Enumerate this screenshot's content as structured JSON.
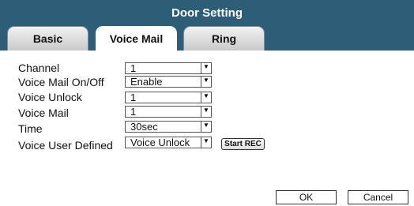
{
  "window": {
    "title": "Door Setting"
  },
  "tabs": [
    {
      "label": "Basic",
      "active": false
    },
    {
      "label": "Voice Mail",
      "active": true
    },
    {
      "label": "Ring",
      "active": false
    }
  ],
  "fields": [
    {
      "label": "Channel",
      "value": "1"
    },
    {
      "label": "Voice Mail On/Off",
      "value": "Enable"
    },
    {
      "label": "Voice Unlock",
      "value": "1"
    },
    {
      "label": "Voice Mail",
      "value": "1"
    },
    {
      "label": "Time",
      "value": "30sec"
    },
    {
      "label": "Voice User Defined",
      "value": "Voice Unlock"
    }
  ],
  "start_rec_label": "Start REC",
  "buttons": {
    "ok": "OK",
    "cancel": "Cancel"
  },
  "dropdown_arrow": "▼",
  "colors": {
    "header": "#2e5d78",
    "background": "#ffffff"
  }
}
